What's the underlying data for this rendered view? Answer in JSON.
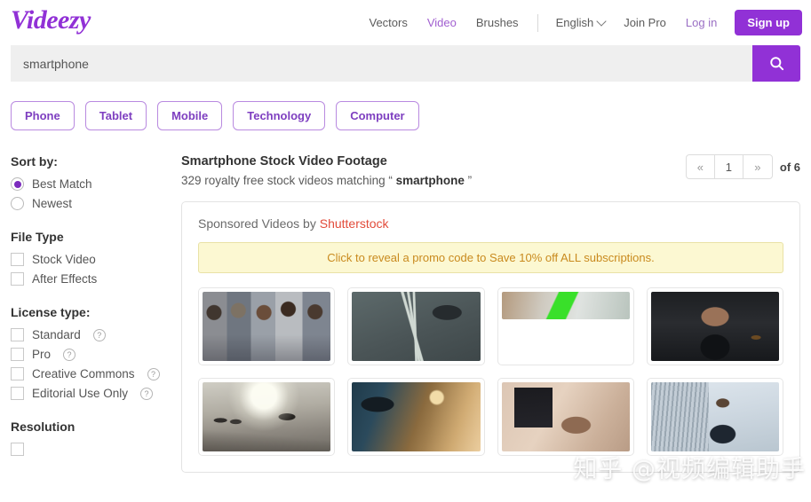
{
  "header": {
    "logo": "Videezy",
    "nav_links": [
      {
        "label": "Vectors",
        "state": "normal"
      },
      {
        "label": "Video",
        "state": "active"
      },
      {
        "label": "Brushes",
        "state": "normal"
      }
    ],
    "language": "English",
    "join_pro": "Join Pro",
    "log_in": "Log in",
    "sign_up": "Sign up"
  },
  "search": {
    "value": "smartphone",
    "placeholder": "Search",
    "button_icon": "search-icon"
  },
  "tags": [
    "Phone",
    "Tablet",
    "Mobile",
    "Technology",
    "Computer"
  ],
  "sidebar": {
    "sort": {
      "heading": "Sort by:",
      "options": [
        {
          "label": "Best Match",
          "selected": true
        },
        {
          "label": "Newest",
          "selected": false
        }
      ]
    },
    "file_type": {
      "heading": "File Type",
      "options": [
        {
          "label": "Stock Video",
          "checked": false
        },
        {
          "label": "After Effects",
          "checked": false
        }
      ]
    },
    "license": {
      "heading": "License type:",
      "options": [
        {
          "label": "Standard",
          "checked": false,
          "help": "?"
        },
        {
          "label": "Pro",
          "checked": false,
          "help": "?"
        },
        {
          "label": "Creative Commons",
          "checked": false,
          "help": "?"
        },
        {
          "label": "Editorial Use Only",
          "checked": false,
          "help": "?"
        }
      ]
    },
    "resolution": {
      "heading": "Resolution"
    }
  },
  "results": {
    "title": "Smartphone Stock Video Footage",
    "subtitle_prefix": "329 royalty free stock videos matching ",
    "subtitle_quote_open": "“ ",
    "subtitle_term": "smartphone",
    "subtitle_quote_close": " ”",
    "count": 329,
    "pagination": {
      "prev": "«",
      "current_page": "1",
      "next": "»",
      "of_label": "of 6",
      "total_pages": 6
    }
  },
  "sponsored": {
    "label_prefix": "Sponsored Videos by ",
    "brand": "Shutterstock",
    "promo": "Click to reveal a promo code to Save 10% off ALL subscriptions.",
    "thumbnails": [
      {
        "name": "five-people-using-phones",
        "art": "art-people",
        "partial": false
      },
      {
        "name": "aerial-man-on-street",
        "art": "art-aerial",
        "partial": false
      },
      {
        "name": "green-screen-phone",
        "art": "art-green",
        "partial": true
      },
      {
        "name": "man-with-headphones-phone",
        "art": "art-headphone",
        "partial": false
      },
      {
        "name": "backlit-street-crowd",
        "art": "art-street",
        "partial": false
      },
      {
        "name": "man-in-warm-room-phone",
        "art": "art-warm",
        "partial": false
      },
      {
        "name": "baby-video-call",
        "art": "art-baby",
        "partial": false
      },
      {
        "name": "businessman-outdoors-phone",
        "art": "art-suit",
        "partial": false
      }
    ]
  },
  "watermark": "知乎 @视频编辑助手",
  "colors": {
    "brand_purple": "#9131d6",
    "tag_purple": "#7e3fc0",
    "shutterstock_red": "#e24b3a",
    "promo_bg": "#fcf8d2",
    "promo_text": "#c98a1e"
  }
}
